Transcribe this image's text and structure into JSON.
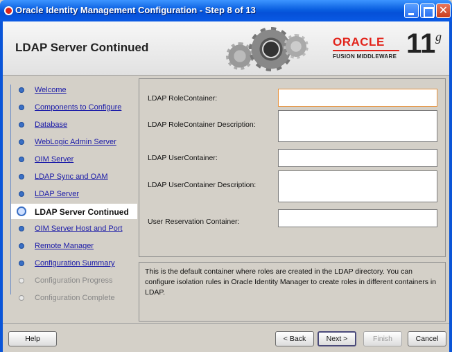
{
  "window": {
    "title": "Oracle Identity Management Configuration - Step 8 of 13"
  },
  "header": {
    "page_title": "LDAP Server Continued",
    "logo_text": "ORACLE",
    "logo_subtext": "FUSION MIDDLEWARE",
    "version": "11",
    "version_suffix": "g"
  },
  "nav": {
    "items": [
      {
        "label": "Welcome",
        "state": "done"
      },
      {
        "label": "Components to Configure",
        "state": "done"
      },
      {
        "label": "Database",
        "state": "done"
      },
      {
        "label": "WebLogic Admin Server",
        "state": "done"
      },
      {
        "label": "OIM Server",
        "state": "done"
      },
      {
        "label": "LDAP Sync and OAM",
        "state": "done"
      },
      {
        "label": "LDAP Server",
        "state": "done"
      },
      {
        "label": "LDAP Server Continued",
        "state": "current"
      },
      {
        "label": "OIM Server Host and Port",
        "state": "todo"
      },
      {
        "label": "Remote Manager",
        "state": "todo"
      },
      {
        "label": "Configuration Summary",
        "state": "todo"
      },
      {
        "label": "Configuration Progress",
        "state": "inactive"
      },
      {
        "label": "Configuration Complete",
        "state": "inactive"
      }
    ]
  },
  "form": {
    "role_container_label": "LDAP RoleContainer:",
    "role_container_value": "",
    "role_container_desc_label": "LDAP RoleContainer Description:",
    "role_container_desc_value": "",
    "user_container_label": "LDAP UserContainer:",
    "user_container_value": "",
    "user_container_desc_label": "LDAP UserContainer Description:",
    "user_container_desc_value": "",
    "user_reservation_label": "User Reservation Container:",
    "user_reservation_value": ""
  },
  "help": {
    "text": "This is the default container where roles are created in the LDAP directory. You can configure isolation rules in Oracle Identity Manager to create roles in different containers in LDAP."
  },
  "buttons": {
    "help": "Help",
    "back": "< Back",
    "next": "Next >",
    "finish": "Finish",
    "cancel": "Cancel"
  },
  "colors": {
    "titlebar": "#0a5fe0",
    "oracle_red": "#e2231a",
    "link": "#1a1aa8",
    "focus": "#e8913a"
  }
}
